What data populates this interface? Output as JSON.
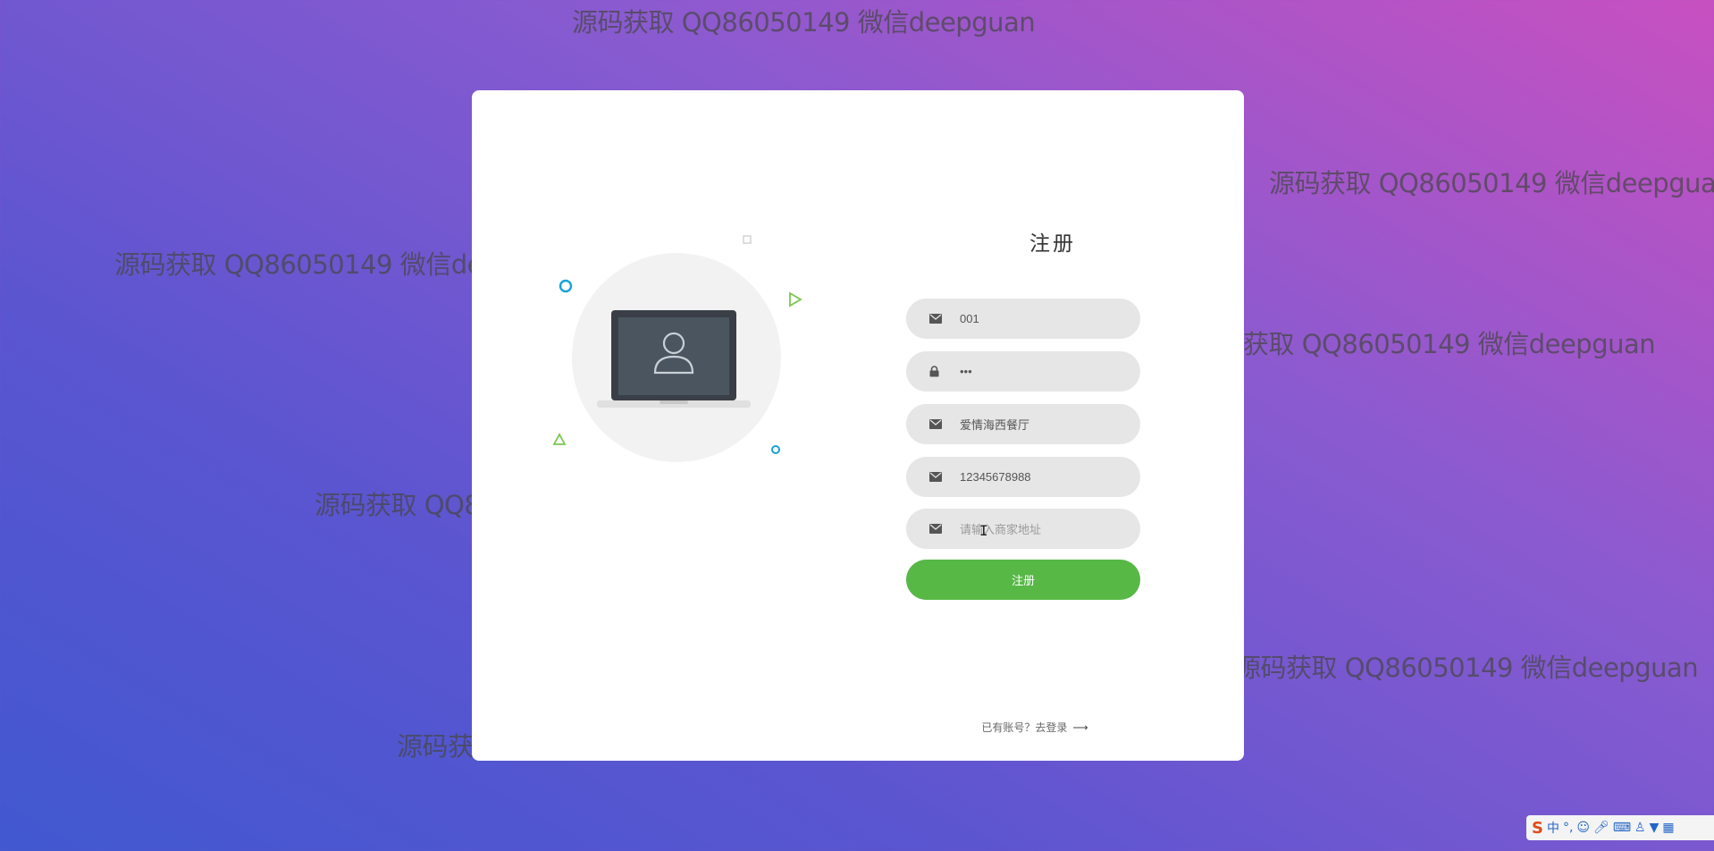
{
  "form": {
    "title": "注册",
    "fields": [
      {
        "icon": "envelope-icon",
        "value": "001",
        "placeholder": ""
      },
      {
        "icon": "lock-icon",
        "value": "•••",
        "placeholder": ""
      },
      {
        "icon": "envelope-icon",
        "value": "爱情海西餐厅",
        "placeholder": ""
      },
      {
        "icon": "envelope-icon",
        "value": "12345678988",
        "placeholder": ""
      },
      {
        "icon": "envelope-icon",
        "value": "",
        "placeholder": "请输入商家地址"
      }
    ],
    "submit_label": "注册",
    "login_link": "已有账号？去登录",
    "login_arrow": "⟶"
  },
  "watermark": "源码获取 QQ86050149 微信deepguan",
  "tray": {
    "ime_logo": "S",
    "ime_mode": "中",
    "punct": "°,",
    "icons": [
      "emoji-icon",
      "mic-icon",
      "keyboard-icon",
      "user-icon",
      "shirt-icon",
      "grid-icon"
    ]
  },
  "colors": {
    "accent_green": "#57b846",
    "field_bg": "#e6e6e6",
    "circle_cyan": "#17a2d6",
    "triangle_green": "#78c850"
  }
}
